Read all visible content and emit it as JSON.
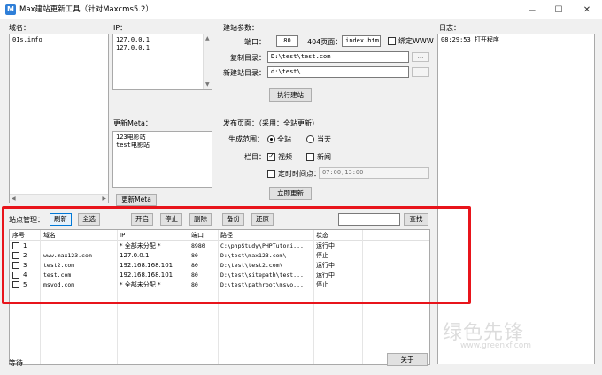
{
  "window": {
    "title": "Max建站更新工具（针对Maxcms5.2）",
    "icon_text": "M",
    "minimize": "—",
    "maximize": "☐",
    "close": "✕"
  },
  "domain_panel": {
    "label": "域名：",
    "content": "01s.info"
  },
  "ip_panel": {
    "label": "IP：",
    "content": "127.0.0.1\n127.0.0.1"
  },
  "meta_panel": {
    "label": "更新Meta：",
    "content": "123电影站\ntest电影站",
    "button": "更新Meta"
  },
  "build_params": {
    "label": "建站参数：",
    "port_label": "端口：",
    "port_value": "80",
    "page404_label": "404页面：",
    "page404_value": "index.htm",
    "bind_www_label": "绑定WWW",
    "copy_dir_label": "复制目录：",
    "copy_dir_value": "D:\\test\\test.com",
    "new_dir_label": "新建站目录：",
    "new_dir_value": "d:\\test\\",
    "browse": "...",
    "execute_button": "执行建站"
  },
  "publish": {
    "label": "发布页面：（采用：全站更新）",
    "scope_label": "生成范围：",
    "scope_all": "全站",
    "scope_today": "当天",
    "column_label": "栏目：",
    "video_label": "视频",
    "news_label": "新闻",
    "schedule_label": "定时时间点：",
    "schedule_value": "07:00,13:00",
    "update_button": "立即更新"
  },
  "log": {
    "label": "日志：",
    "entries": [
      "08:29:53 打开程序"
    ]
  },
  "site_manager": {
    "label": "站点管理：",
    "buttons": {
      "refresh": "刷新",
      "select_all": "全选",
      "start": "开启",
      "stop": "停止",
      "delete": "删除",
      "backup": "备份",
      "restore": "还原",
      "search": "查找"
    },
    "search_value": "",
    "columns": [
      "序号",
      "域名",
      "IP",
      "端口",
      "路径",
      "状态"
    ],
    "rows": [
      {
        "no": "1",
        "domain": "",
        "ip": "* 全部未分配 *",
        "port": "8980",
        "path": "C:\\phpStudy\\PHPTutori...",
        "status": "运行中"
      },
      {
        "no": "2",
        "domain": "www.max123.com",
        "ip": "127.0.0.1",
        "port": "80",
        "path": "D:\\test\\max123.com\\",
        "status": "停止"
      },
      {
        "no": "3",
        "domain": "test2.com",
        "ip": "192.168.168.101",
        "port": "80",
        "path": "D:\\test\\test2.com\\",
        "status": "运行中"
      },
      {
        "no": "4",
        "domain": "test.com",
        "ip": "192.168.168.101",
        "port": "80",
        "path": "D:\\test\\sitepath\\test...",
        "status": "运行中"
      },
      {
        "no": "5",
        "domain": "msvod.com",
        "ip": "* 全部未分配 *",
        "port": "80",
        "path": "D:\\test\\pathroot\\msvo...",
        "status": "停止"
      }
    ]
  },
  "status_bar": {
    "text": "等待",
    "about_button": "关于"
  },
  "watermark": {
    "text": "绿色先锋",
    "url": "www.greenxf.com"
  }
}
